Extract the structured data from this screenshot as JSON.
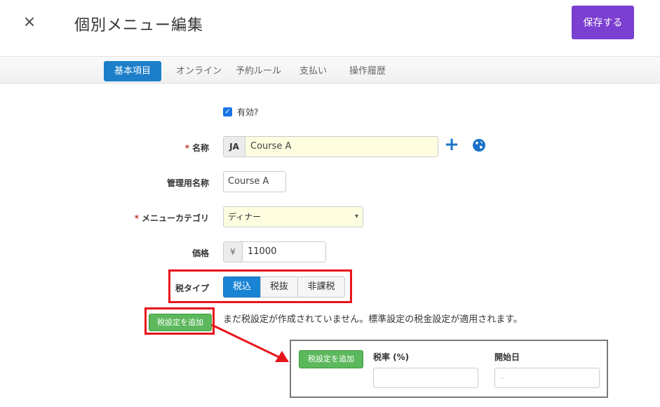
{
  "header": {
    "close_glyph": "×",
    "title": "個別メニュー編集",
    "save_label": "保存する"
  },
  "tabs": [
    {
      "label": "基本項目",
      "active": true
    },
    {
      "label": "オンライン",
      "active": false
    },
    {
      "label": "予約ルール",
      "active": false
    },
    {
      "label": "支払い",
      "active": false
    },
    {
      "label": "操作履歴",
      "active": false
    }
  ],
  "form": {
    "enabled_label": "有効?",
    "enabled_checked": true,
    "required_mark": "*",
    "name_label": "名称",
    "name_lang": "JA",
    "name_value": "Course A",
    "admin_name_label": "管理用名称",
    "admin_name_value": "Course A",
    "category_label": "メニューカテゴリ",
    "category_value": "ディナー",
    "price_label": "価格",
    "currency_symbol": "¥",
    "price_value": "11000",
    "tax_type_label": "税タイプ",
    "tax_options": [
      "税込",
      "税抜",
      "非課税"
    ],
    "tax_selected": "税込",
    "add_tax_label": "税設定を追加",
    "tax_note": "まだ税設定が作成されていません。標準設定の税金設定が適用されます。"
  },
  "callout": {
    "add_tax_label": "税設定を追加",
    "tax_rate_label": "税率 (%)",
    "tax_rate_value": "",
    "start_date_label": "開始日",
    "start_date_value": "-"
  },
  "colors": {
    "accent_purple": "#7b3fd1",
    "tab_active": "#1d7fc9",
    "highlight_red": "#e8141c",
    "green_button": "#5cb85c"
  }
}
